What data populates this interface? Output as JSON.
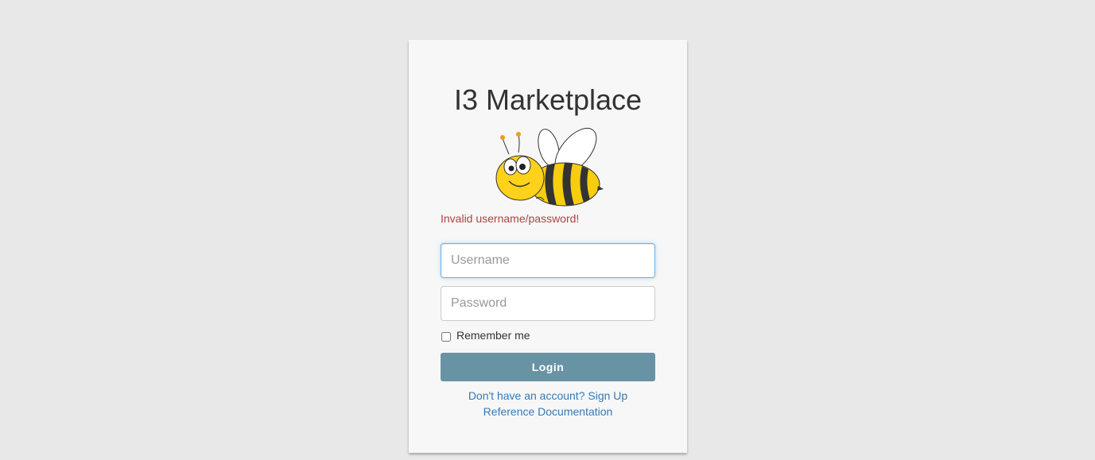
{
  "app": {
    "title": "I3 Marketplace",
    "logo": "bee-mascot"
  },
  "alert": {
    "error_text": "Invalid username/password!"
  },
  "form": {
    "username_placeholder": "Username",
    "password_placeholder": "Password",
    "remember_label": "Remember me",
    "remember_checked": false,
    "login_label": "Login"
  },
  "links": {
    "signup": "Don't have an account? Sign Up",
    "docs": "Reference Documentation"
  },
  "colors": {
    "background": "#e8e8e8",
    "card": "#f7f7f7",
    "error": "#a94442",
    "button": "#6893a5",
    "link": "#337ab7"
  }
}
